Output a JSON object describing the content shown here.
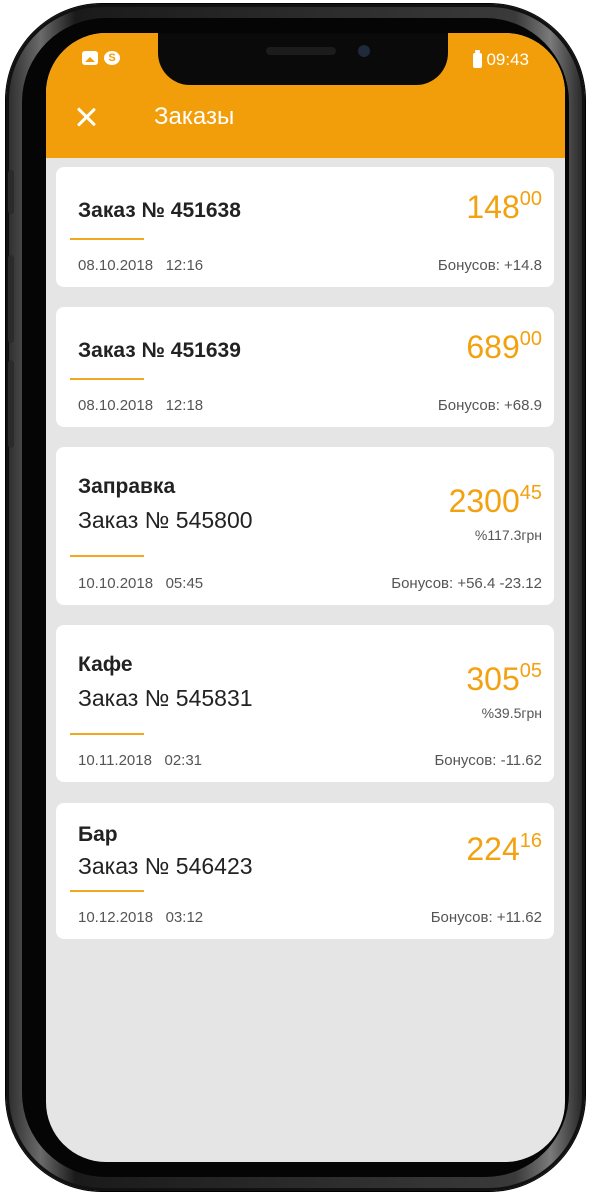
{
  "status_bar": {
    "time": "09:43"
  },
  "header": {
    "title": "Заказы"
  },
  "orders": [
    {
      "name": "",
      "order": "Заказ № 451638",
      "price_main": "148",
      "price_cents": "00",
      "percent": "",
      "date": "08.10.2018",
      "time": "12:16",
      "bonus": "Бонусов: +14.8"
    },
    {
      "name": "",
      "order": "Заказ № 451639",
      "price_main": "689",
      "price_cents": "00",
      "percent": "",
      "date": "08.10.2018",
      "time": "12:18",
      "bonus": "Бонусов: +68.9"
    },
    {
      "name": "Заправка",
      "order": "Заказ № 545800",
      "price_main": "2300",
      "price_cents": "45",
      "percent": "%117.3грн",
      "date": "10.10.2018",
      "time": "05:45",
      "bonus": "Бонусов: +56.4 -23.12"
    },
    {
      "name": "Кафе",
      "order": "Заказ № 545831",
      "price_main": "305",
      "price_cents": "05",
      "percent": "%39.5грн",
      "date": "10.11.2018",
      "time": "02:31",
      "bonus": "Бонусов: -11.62"
    },
    {
      "name": "Бар",
      "order": "Заказ № 546423",
      "price_main": "224",
      "price_cents": "16",
      "percent": "",
      "date": "10.12.2018",
      "time": "03:12",
      "bonus": "Бонусов: +11.62"
    }
  ],
  "colors": {
    "accent": "#f29e0a",
    "background": "#e5e5e5",
    "card": "#ffffff"
  }
}
